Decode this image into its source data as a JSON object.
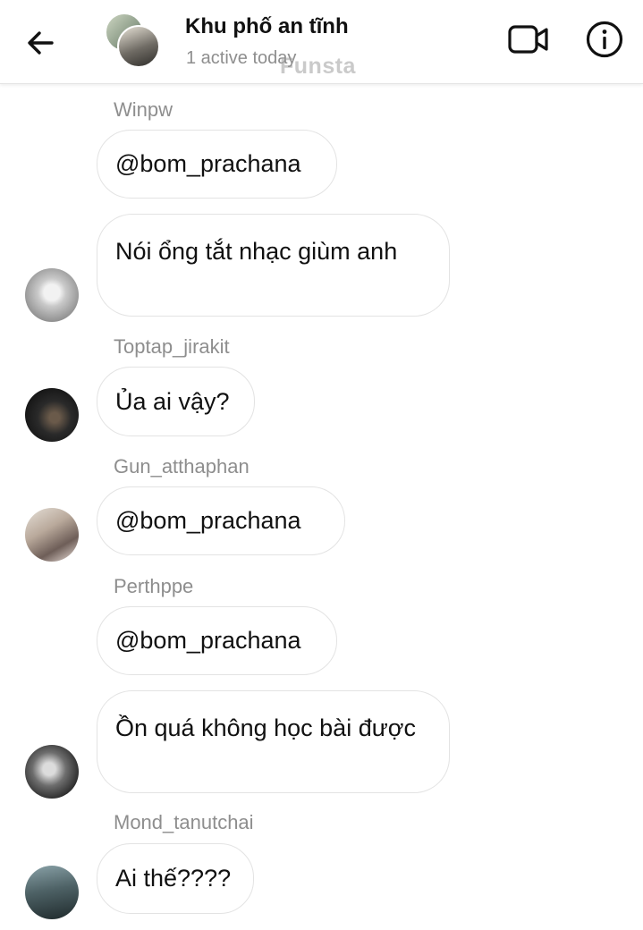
{
  "header": {
    "title": "Khu phố an tĩnh",
    "subtitle": "1 active today",
    "watermark": "Funsta",
    "icons": {
      "back": "arrow-left-icon",
      "video": "video-camera-icon",
      "info": "info-icon"
    }
  },
  "messages": [
    {
      "sender": "Winpw",
      "bubbles": [
        "@bom_prachana",
        "Nói ổng tắt nhạc giùm anh"
      ]
    },
    {
      "sender": "Toptap_jirakit",
      "bubbles": [
        "Ủa ai vậy?"
      ]
    },
    {
      "sender": "Gun_atthaphan",
      "bubbles": [
        "@bom_prachana"
      ]
    },
    {
      "sender": "Perthppe",
      "bubbles": [
        "@bom_prachana",
        "Ồn quá không học bài được"
      ]
    },
    {
      "sender": "Mond_tanutchai",
      "bubbles": [
        "Ai thế????"
      ]
    }
  ],
  "colors": {
    "muted_text": "#8e8e8e",
    "bubble_border": "#e3e3e3"
  }
}
